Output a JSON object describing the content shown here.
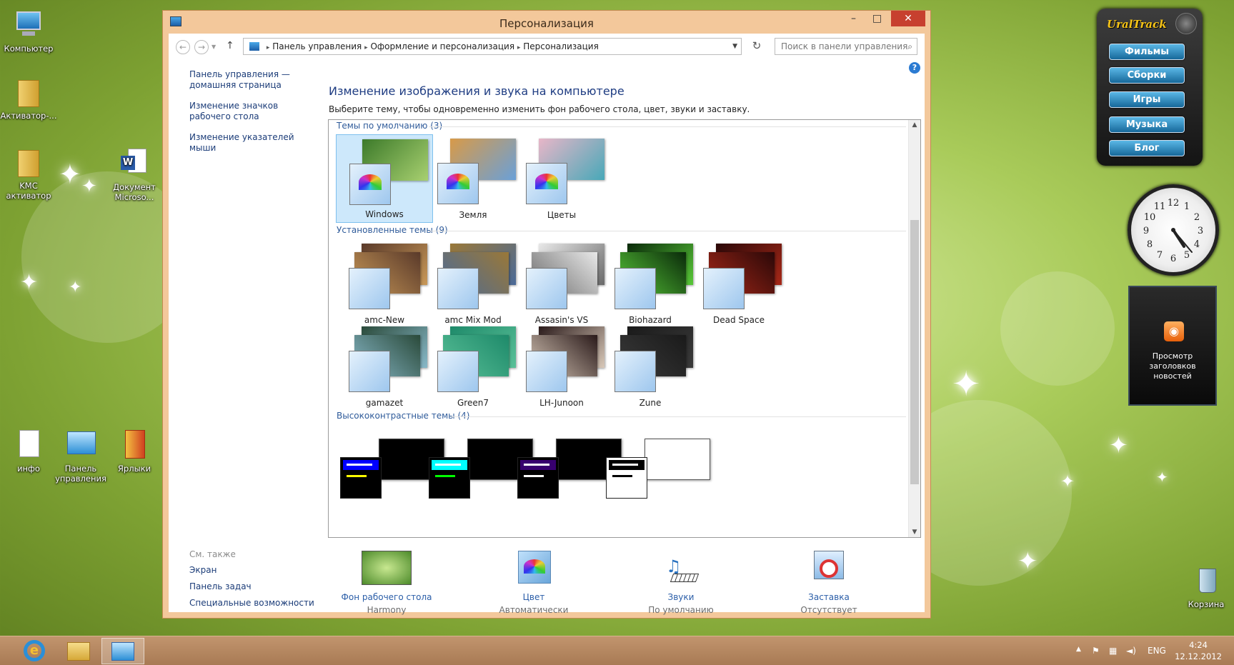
{
  "desktop": {
    "icons": [
      {
        "label": "Компьютер"
      },
      {
        "label": "Активатор-..."
      },
      {
        "label": "KMC активатор"
      },
      {
        "label": "Документ Microso..."
      },
      {
        "label": "инфо"
      },
      {
        "label": "Панель управления"
      },
      {
        "label": "Ярлыки"
      },
      {
        "label": "Корзина"
      }
    ]
  },
  "window": {
    "title": "Персонализация",
    "controls": {
      "minimize": "–",
      "maximize": "□",
      "close": "✕"
    },
    "address": {
      "root_icon": "control-panel-icon",
      "crumbs": [
        "Панель управления",
        "Оформление и персонализация",
        "Персонализация"
      ],
      "separator": "▸"
    },
    "search": {
      "placeholder": "Поиск в панели управления"
    },
    "left_links": [
      "Панель управления — домашняя страница",
      "Изменение значков рабочего стола",
      "Изменение указателей мыши"
    ],
    "see_also": {
      "heading": "См. также",
      "links": [
        "Экран",
        "Панель задач",
        "Специальные возможности"
      ]
    },
    "heading": "Изменение изображения и звука на компьютере",
    "subheading": "Выберите тему, чтобы одновременно изменить фон рабочего стола, цвет, звуки и заставку.",
    "groups": [
      {
        "title": "Темы по умолчанию (3)",
        "themes": [
          {
            "name": "Windows",
            "selected": true,
            "colors": [
              "#3c7a2a",
              "#a8d070"
            ]
          },
          {
            "name": "Земля",
            "colors": [
              "#d89a48",
              "#6aa0d8"
            ]
          },
          {
            "name": "Цветы",
            "colors": [
              "#e8b6c8",
              "#48a8b8"
            ]
          }
        ]
      },
      {
        "title": "Установленные темы (9)",
        "themes": [
          {
            "name": "amc-New",
            "colors": [
              "#5a3a2a",
              "#c89858"
            ]
          },
          {
            "name": "amc Mix Mod",
            "colors": [
              "#9a7838",
              "#4a6a98"
            ]
          },
          {
            "name": "Assasin's VS",
            "colors": [
              "#e8e8e8",
              "#6a6a6a"
            ]
          },
          {
            "name": "Biohazard",
            "colors": [
              "#0a2a0a",
              "#58c838"
            ]
          },
          {
            "name": "Dead Space",
            "colors": [
              "#2a0808",
              "#a82818"
            ]
          },
          {
            "name": "gamazet",
            "colors": [
              "#2a4a3a",
              "#88b8c8"
            ]
          },
          {
            "name": "Green7",
            "colors": [
              "#1e8a6a",
              "#5ac098"
            ]
          },
          {
            "name": "LH-Junoon",
            "colors": [
              "#2a1a1a",
              "#d8c8b8"
            ]
          },
          {
            "name": "Zune",
            "colors": [
              "#1a1a1a",
              "#3a3a3a"
            ]
          }
        ]
      },
      {
        "title": "Высококонтрастные темы (4)",
        "themes": [
          {
            "name": "",
            "hc": [
              "#000000",
              "#0000ff",
              "#ffff00"
            ]
          },
          {
            "name": "",
            "hc": [
              "#000000",
              "#00ffff",
              "#00ff00"
            ]
          },
          {
            "name": "",
            "hc": [
              "#000000",
              "#37006e",
              "#ffffff"
            ]
          },
          {
            "name": "",
            "hc": [
              "#ffffff",
              "#000000",
              "#000000"
            ]
          }
        ]
      }
    ],
    "bottom": [
      {
        "title": "Фон рабочего стола",
        "status": "Harmony",
        "icon": "desktop-background-icon"
      },
      {
        "title": "Цвет",
        "status": "Автоматически",
        "icon": "color-icon"
      },
      {
        "title": "Звуки",
        "status": "По умолчанию",
        "icon": "sounds-icon"
      },
      {
        "title": "Заставка",
        "status": "Отсутствует",
        "icon": "screensaver-icon"
      }
    ]
  },
  "gadgets": {
    "uraltrack": {
      "logo": "UralTrack",
      "buttons": [
        "Фильмы",
        "Сборки",
        "Игры",
        "Музыка",
        "Блог"
      ]
    },
    "news": {
      "label": "Просмотр заголовков новостей"
    }
  },
  "taskbar": {
    "lang": "ENG",
    "time": "4:24",
    "date": "12.12.2012"
  }
}
